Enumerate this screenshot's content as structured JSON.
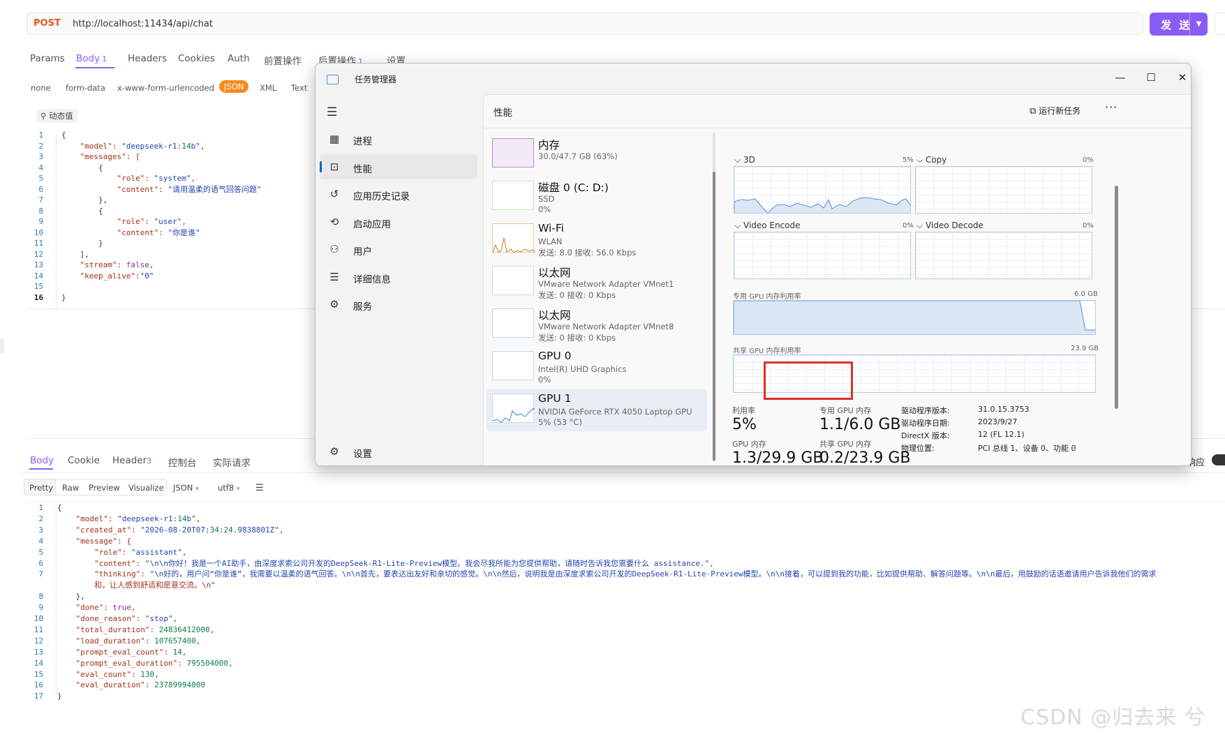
{
  "request": {
    "method": "POST",
    "url": "http://localhost:11434/api/chat",
    "send_label": "发 送",
    "tabs": [
      {
        "label": "Params"
      },
      {
        "label": "Body",
        "badge": "1"
      },
      {
        "label": "Headers"
      },
      {
        "label": "Cookies"
      },
      {
        "label": "Auth"
      },
      {
        "label": "前置操作"
      },
      {
        "label": "后置操作",
        "badge": "1"
      },
      {
        "label": "设置"
      }
    ],
    "content_types": [
      "none",
      "form-data",
      "x-www-form-urlencoded",
      "JSON",
      "XML",
      "Text"
    ],
    "dynamic_value_label": "动态值",
    "body_lines": [
      "{",
      "    \"model\": \"deepseek-r1:14b\",",
      "    \"messages\": [",
      "        {",
      "            \"role\": \"system\",",
      "            \"content\": \"请用温柔的语气回答问题\"",
      "        },",
      "        {",
      "            \"role\": \"user\",",
      "            \"content\": \"你是谁\"",
      "        }",
      "    ],",
      "    \"stream\": false,",
      "    \"keep_alive\":\"0\"",
      "",
      "}"
    ]
  },
  "response": {
    "tabs": [
      {
        "label": "Body"
      },
      {
        "label": "Cookie"
      },
      {
        "label": "Header",
        "badge": "3"
      },
      {
        "label": "控制台"
      },
      {
        "label": "实际请求"
      }
    ],
    "view_modes": [
      "Pretty",
      "Raw",
      "Preview",
      "Visualize"
    ],
    "format": "JSON",
    "encoding": "utf8",
    "right_label": "响应",
    "body_lines": [
      {
        "n": "1",
        "t": "{"
      },
      {
        "n": "2",
        "t": "    \"model\": \"deepseek-r1:14b\","
      },
      {
        "n": "3",
        "t": "    \"created_at\": \"2026-08-20T07:34:24.9838801Z\","
      },
      {
        "n": "4",
        "t": "    \"message\": {"
      },
      {
        "n": "5",
        "t": "        \"role\": \"assistant\","
      },
      {
        "n": "6",
        "t": "        \"content\": \"\\n\\n你好！我是一个AI助手，由深度求索公司开发的DeepSeek-R1-Lite-Preview模型。我会尽我所能为您提供帮助，请随时告诉我您需要什么 assistance.\","
      },
      {
        "n": "7",
        "t": "        \"thinking\": \"\\n好的，用户问“你是谁”，我需要以温柔的语气回答。\\n\\n首先，要表达出友好和亲切的感觉。\\n\\n然后，说明我是由深度求索公司开发的DeepSeek-R1-Lite-Preview模型。\\n\\n接着，可以提到我的功能，比如提供帮助、解答问题等。\\n\\n最后，用鼓励的话语邀请用户告诉我他们的需求"
      },
      {
        "n": "",
        "t": "        和，让人感到舒适和愿意交流。\\n\""
      },
      {
        "n": "8",
        "t": "    },"
      },
      {
        "n": "9",
        "t": "    \"done\": true,"
      },
      {
        "n": "10",
        "t": "    \"done_reason\": \"stop\","
      },
      {
        "n": "11",
        "t": "    \"total_duration\": 24836412000,"
      },
      {
        "n": "12",
        "t": "    \"load_duration\": 107657400,"
      },
      {
        "n": "13",
        "t": "    \"prompt_eval_count\": 14,"
      },
      {
        "n": "14",
        "t": "    \"prompt_eval_duration\": 795504000,"
      },
      {
        "n": "15",
        "t": "    \"eval_count\": 130,"
      },
      {
        "n": "16",
        "t": "    \"eval_duration\": 23789994000"
      },
      {
        "n": "17",
        "t": "}"
      }
    ]
  },
  "task_manager": {
    "title": "任务管理器",
    "nav": [
      {
        "label": "进程",
        "icon": "grid-icon"
      },
      {
        "label": "性能",
        "icon": "performance-icon",
        "selected": true
      },
      {
        "label": "应用历史记录",
        "icon": "history-icon"
      },
      {
        "label": "启动应用",
        "icon": "startup-icon"
      },
      {
        "label": "用户",
        "icon": "users-icon"
      },
      {
        "label": "详细信息",
        "icon": "details-icon"
      },
      {
        "label": "服务",
        "icon": "services-icon"
      }
    ],
    "settings_label": "设置",
    "page_title": "性能",
    "run_new_task": "运行新任务",
    "devices": [
      {
        "name": "内存",
        "line2": "30.0/47.7 GB (63%)",
        "line3": ""
      },
      {
        "name": "磁盘 0 (C: D:)",
        "line2": "SSD",
        "line3": "0%"
      },
      {
        "name": "Wi-Fi",
        "line2": "WLAN",
        "line3": "发送: 8.0  接收: 56.0 Kbps"
      },
      {
        "name": "以太网",
        "line2": "VMware Network Adapter VMnet1",
        "line3": "发送: 0  接收: 0 Kbps"
      },
      {
        "name": "以太网",
        "line2": "VMware Network Adapter VMnet8",
        "line3": "发送: 0  接收: 0 Kbps"
      },
      {
        "name": "GPU 0",
        "line2": "Intel(R) UHD Graphics",
        "line3": "0%"
      },
      {
        "name": "GPU 1",
        "line2": "NVIDIA GeForce RTX 4050 Laptop GPU",
        "line3": "5%  (53 °C)"
      }
    ],
    "engines": [
      {
        "name": "3D",
        "value": "5%"
      },
      {
        "name": "Copy",
        "value": "0%"
      },
      {
        "name": "Video Encode",
        "value": "0%"
      },
      {
        "name": "Video Decode",
        "value": "0%"
      }
    ],
    "dedicated_mem_label": "专用 GPU 内存利用率",
    "dedicated_mem_max": "6.0 GB",
    "shared_mem_label": "共享 GPU 内存利用率",
    "shared_mem_max": "23.9 GB",
    "stats": {
      "util_label": "利用率",
      "util_value": "5%",
      "dedicated_label": "专用 GPU 内存",
      "dedicated_value": "1.1/6.0 GB",
      "gpu_mem_label": "GPU 内存",
      "gpu_mem_value": "1.3/29.9 GB",
      "shared_label": "共享 GPU 内存",
      "shared_value": "0.2/23.9 GB"
    },
    "details": [
      {
        "k": "驱动程序版本:",
        "v": "31.0.15.3753"
      },
      {
        "k": "驱动程序日期:",
        "v": "2023/9/27"
      },
      {
        "k": "DirectX 版本:",
        "v": "12 (FL 12.1)"
      },
      {
        "k": "物理位置:",
        "v": "PCI 总线 1、设备 0、功能 0"
      }
    ]
  },
  "watermark": "CSDN @归去来 兮"
}
